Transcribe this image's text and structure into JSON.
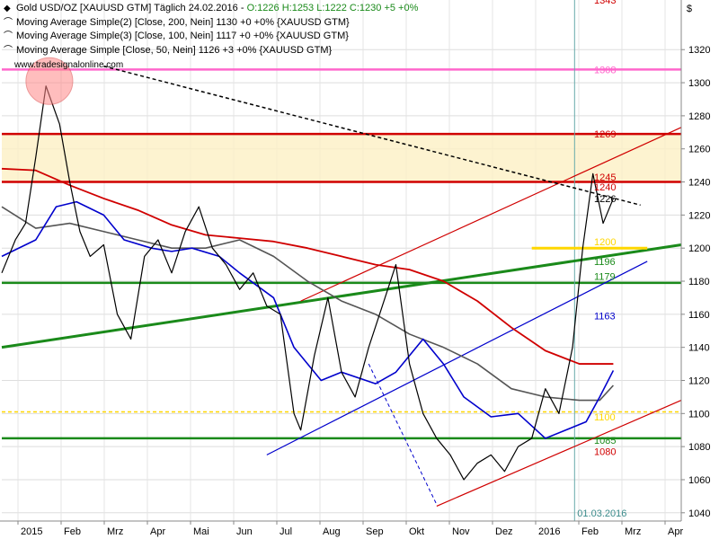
{
  "chart_data": {
    "type": "line",
    "title": "Gold USD/OZ [XAUUSD GTM] Täglich 24.02.2016",
    "ylim": [
      1035,
      1350
    ],
    "y_ticks": [
      1040,
      1060,
      1080,
      1100,
      1120,
      1140,
      1160,
      1180,
      1200,
      1220,
      1240,
      1260,
      1280,
      1300,
      1320
    ],
    "x_ticks": [
      "2015",
      "Feb",
      "Mrz",
      "Apr",
      "Mai",
      "Jun",
      "Jul",
      "Aug",
      "Sep",
      "Okt",
      "Nov",
      "Dez",
      "2016",
      "Feb",
      "Mrz",
      "Apr"
    ],
    "x_date_label": "01.03.2016",
    "legend": [
      {
        "symbol": "◆",
        "text_main": "Gold USD/OZ [XAUUSD GTM]  Täglich  24.02.2016  - ",
        "text_colored": "O:1226  H:1253  L:1222  C:1230  +5  +0%",
        "color": "#1a8a1a"
      },
      {
        "symbol": "⌒",
        "text_main": "Moving Average Simple(2) [Close, 200, Nein]  1130  +0  +0%  {XAUUSD GTM}",
        "color": "#d00000"
      },
      {
        "symbol": "⌒",
        "text_main": "Moving Average Simple(3) [Close, 100, Nein]  1117  +0  +0%  {XAUUSD GTM}",
        "color": "#444444"
      },
      {
        "symbol": "⌒",
        "text_main": "Moving Average Simple [Close, 50, Nein]  1126  +3  +0%  {XAUUSD GTM}",
        "color": "#0000cc"
      }
    ],
    "watermark": "www.tradesignalonline.com",
    "level_labels": [
      {
        "text": "1343",
        "value": 1350,
        "color": "#d00000"
      },
      {
        "text": "1308",
        "value": 1308,
        "color": "#ff66cc"
      },
      {
        "text": "1269",
        "value": 1269,
        "color": "#d00000"
      },
      {
        "text": "1245",
        "value": 1243,
        "color": "#d00000"
      },
      {
        "text": "1240",
        "value": 1237,
        "color": "#d00000"
      },
      {
        "text": "1226",
        "value": 1230,
        "color": "#000000"
      },
      {
        "text": "1200",
        "value": 1204,
        "color": "#ffd700"
      },
      {
        "text": "1196",
        "value": 1192,
        "color": "#1a8a1a"
      },
      {
        "text": "1179",
        "value": 1183,
        "color": "#1a8a1a"
      },
      {
        "text": "1163",
        "value": 1159,
        "color": "#0000cc"
      },
      {
        "text": "1100",
        "value": 1098,
        "color": "#ffd700"
      },
      {
        "text": "1085",
        "value": 1084,
        "color": "#1a8a1a"
      },
      {
        "text": "1080",
        "value": 1077,
        "color": "#d00000"
      }
    ],
    "horizontal_levels": [
      {
        "value": 1308,
        "color": "#ff66cc"
      },
      {
        "value": 1269,
        "color": "#d00000"
      },
      {
        "value": 1240,
        "color": "#d00000"
      },
      {
        "value": 1179,
        "color": "#1a8a1a"
      },
      {
        "value": 1085,
        "color": "#1a8a1a"
      },
      {
        "value": 1101,
        "color": "#ffd700",
        "dashed": true
      }
    ],
    "resistance_zone": [
      1240,
      1269
    ],
    "price": {
      "color": "#000000",
      "x": [
        0,
        0.02,
        0.035,
        0.05,
        0.065,
        0.085,
        0.1,
        0.115,
        0.13,
        0.15,
        0.17,
        0.19,
        0.21,
        0.23,
        0.25,
        0.27,
        0.29,
        0.31,
        0.33,
        0.35,
        0.37,
        0.39,
        0.41,
        0.43,
        0.44,
        0.46,
        0.48,
        0.5,
        0.52,
        0.54,
        0.56,
        0.58,
        0.6,
        0.62,
        0.64,
        0.66,
        0.68,
        0.7,
        0.72,
        0.74,
        0.76,
        0.78,
        0.8,
        0.82,
        0.84,
        0.855,
        0.87,
        0.885,
        0.9
      ],
      "y": [
        1185,
        1205,
        1215,
        1255,
        1298,
        1275,
        1240,
        1210,
        1195,
        1202,
        1160,
        1145,
        1195,
        1205,
        1185,
        1210,
        1225,
        1200,
        1190,
        1175,
        1185,
        1165,
        1160,
        1100,
        1090,
        1135,
        1170,
        1125,
        1110,
        1140,
        1165,
        1190,
        1130,
        1100,
        1085,
        1075,
        1060,
        1070,
        1075,
        1065,
        1080,
        1085,
        1115,
        1100,
        1140,
        1200,
        1245,
        1215,
        1230
      ]
    },
    "ma200": {
      "color": "#d00000",
      "x": [
        0,
        0.05,
        0.1,
        0.15,
        0.2,
        0.25,
        0.3,
        0.35,
        0.4,
        0.45,
        0.5,
        0.55,
        0.6,
        0.65,
        0.7,
        0.75,
        0.8,
        0.85,
        0.9
      ],
      "y": [
        1248,
        1247,
        1238,
        1230,
        1223,
        1214,
        1208,
        1206,
        1204,
        1200,
        1195,
        1190,
        1187,
        1180,
        1168,
        1152,
        1138,
        1130,
        1130
      ]
    },
    "ma100": {
      "color": "#555555",
      "x": [
        0,
        0.05,
        0.1,
        0.15,
        0.2,
        0.25,
        0.3,
        0.35,
        0.4,
        0.45,
        0.5,
        0.55,
        0.6,
        0.65,
        0.7,
        0.75,
        0.8,
        0.85,
        0.88,
        0.9
      ],
      "y": [
        1225,
        1212,
        1215,
        1210,
        1205,
        1200,
        1200,
        1205,
        1195,
        1180,
        1168,
        1160,
        1148,
        1140,
        1130,
        1115,
        1110,
        1108,
        1108,
        1117
      ]
    },
    "ma50": {
      "color": "#0000cc",
      "x": [
        0,
        0.05,
        0.08,
        0.11,
        0.15,
        0.18,
        0.22,
        0.25,
        0.28,
        0.32,
        0.35,
        0.4,
        0.43,
        0.47,
        0.5,
        0.55,
        0.58,
        0.62,
        0.65,
        0.68,
        0.72,
        0.76,
        0.8,
        0.83,
        0.86,
        0.88,
        0.9
      ],
      "y": [
        1195,
        1205,
        1225,
        1228,
        1220,
        1205,
        1200,
        1198,
        1200,
        1195,
        1185,
        1170,
        1140,
        1120,
        1125,
        1118,
        1125,
        1145,
        1130,
        1110,
        1098,
        1100,
        1085,
        1090,
        1095,
        1110,
        1126
      ]
    },
    "support_long": {
      "color": "#1a8a1a",
      "x": [
        0,
        1
      ],
      "y": [
        1140,
        1202
      ]
    },
    "channel_red_lower": {
      "color": "#d00000",
      "x": [
        0.64,
        1
      ],
      "y": [
        1044,
        1108
      ]
    },
    "channel_red_upper": {
      "color": "#d00000",
      "x": [
        0.44,
        1
      ],
      "y": [
        1168,
        1273
      ]
    },
    "channel_blue_lower": {
      "color": "#0000cc",
      "x": [
        0.39,
        0.95
      ],
      "y": [
        1075,
        1192
      ]
    },
    "trend_dashed_black": {
      "color": "#000000",
      "x": [
        0.15,
        0.94
      ],
      "y": [
        1310,
        1226
      ]
    },
    "trend_dashed_blue": {
      "color": "#0000cc",
      "x": [
        0.54,
        0.64
      ],
      "y": [
        1130,
        1045
      ]
    },
    "yellow_level_short": {
      "color": "#ffd700",
      "x": [
        0.78,
        0.95
      ],
      "y": [
        1200,
        1200
      ]
    },
    "vertical_marker": {
      "x": 0.843,
      "color": "#6aa"
    },
    "peak_marker": {
      "x": 0.07,
      "y": 1301,
      "color": "#ff8888"
    }
  }
}
